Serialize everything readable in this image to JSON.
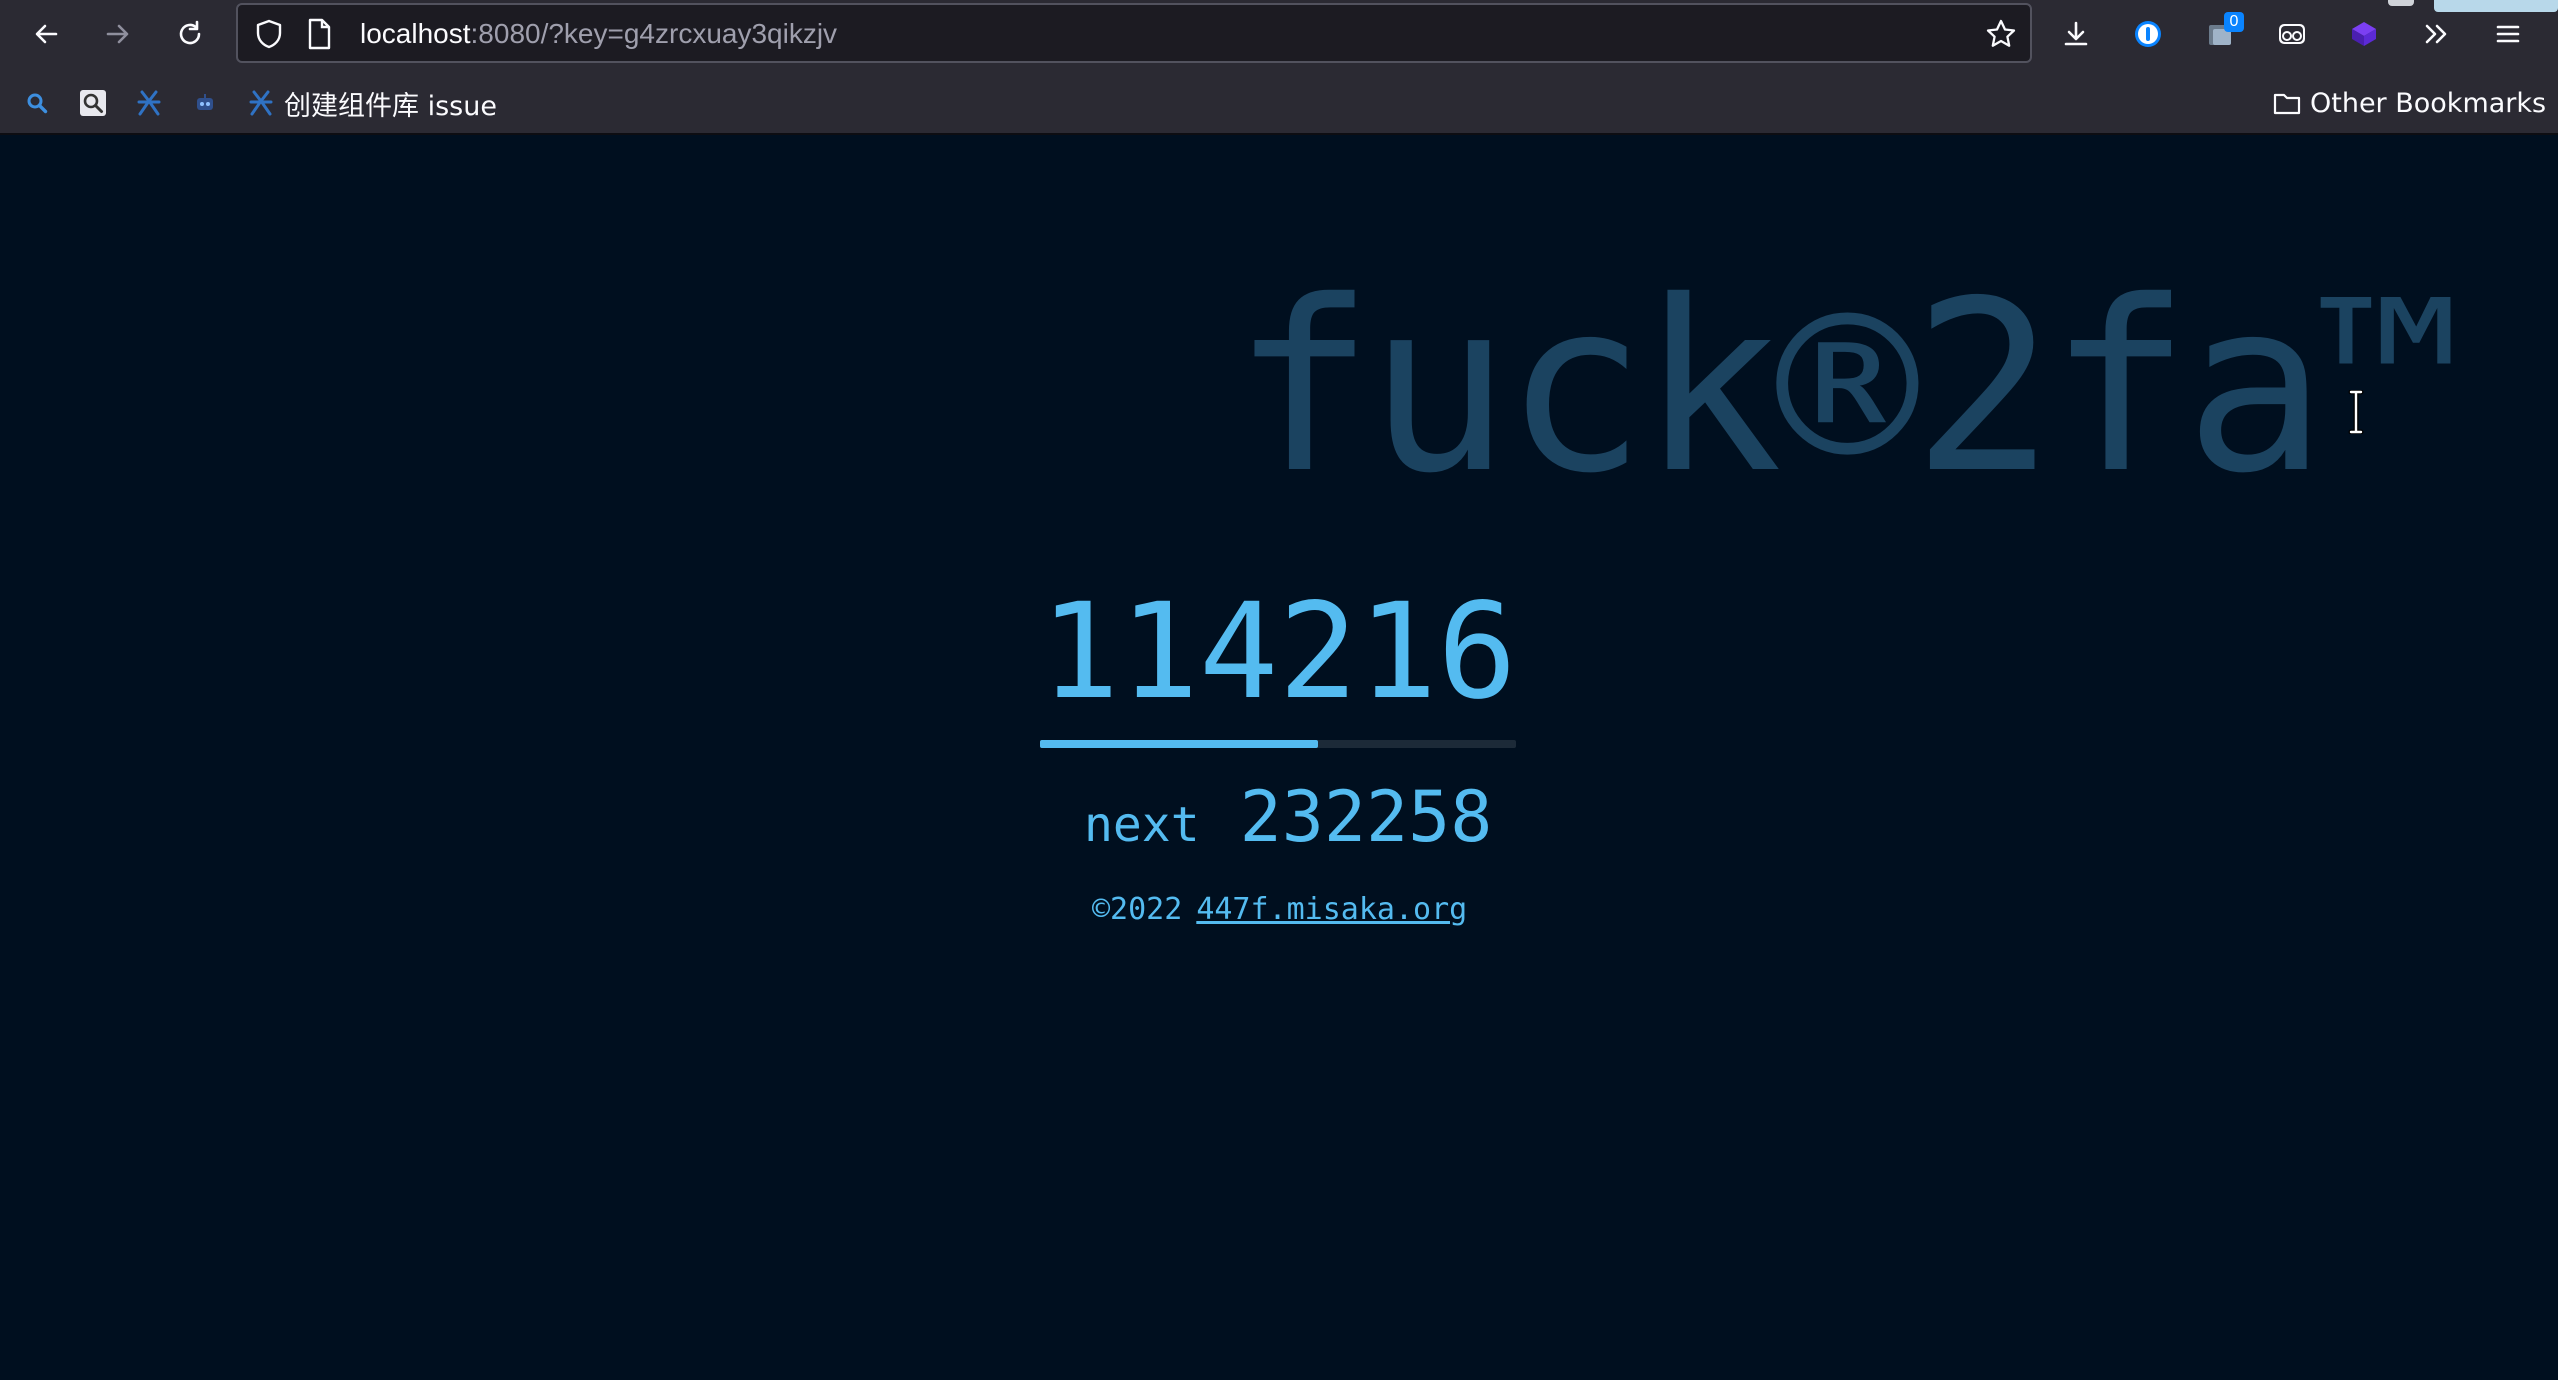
{
  "browser": {
    "url_host": "localhost",
    "url_rest": ":8080/?key=g4zrcxuay3qikzjv",
    "extensions": [
      {
        "name": "onepassword-icon"
      },
      {
        "name": "extension-counter-icon",
        "badge": "0"
      },
      {
        "name": "glasses-icon"
      },
      {
        "name": "purple-cube-icon"
      }
    ]
  },
  "bookmarks": {
    "items": [
      {
        "icon": "search-bookmark-icon",
        "label": ""
      },
      {
        "icon": "magnifier-bookmark-icon",
        "label": ""
      },
      {
        "icon": "github-bookmark-icon",
        "label": ""
      },
      {
        "icon": "robot-bookmark-icon",
        "label": ""
      },
      {
        "icon": "github-bookmark-icon",
        "label": "创建组件库 issue"
      }
    ],
    "other_label": "Other Bookmarks"
  },
  "page": {
    "hero_title": "fuck®2fa™",
    "current_code": "114216",
    "progress": 0.585,
    "next_label": "next",
    "next_code": "232258",
    "copyright": "©2022",
    "footer_link": "447f.misaka.org"
  },
  "colors": {
    "background": "#000f1f",
    "accent": "#54bbf0",
    "hero": "#1b4360",
    "chrome": "#2b2a33"
  }
}
